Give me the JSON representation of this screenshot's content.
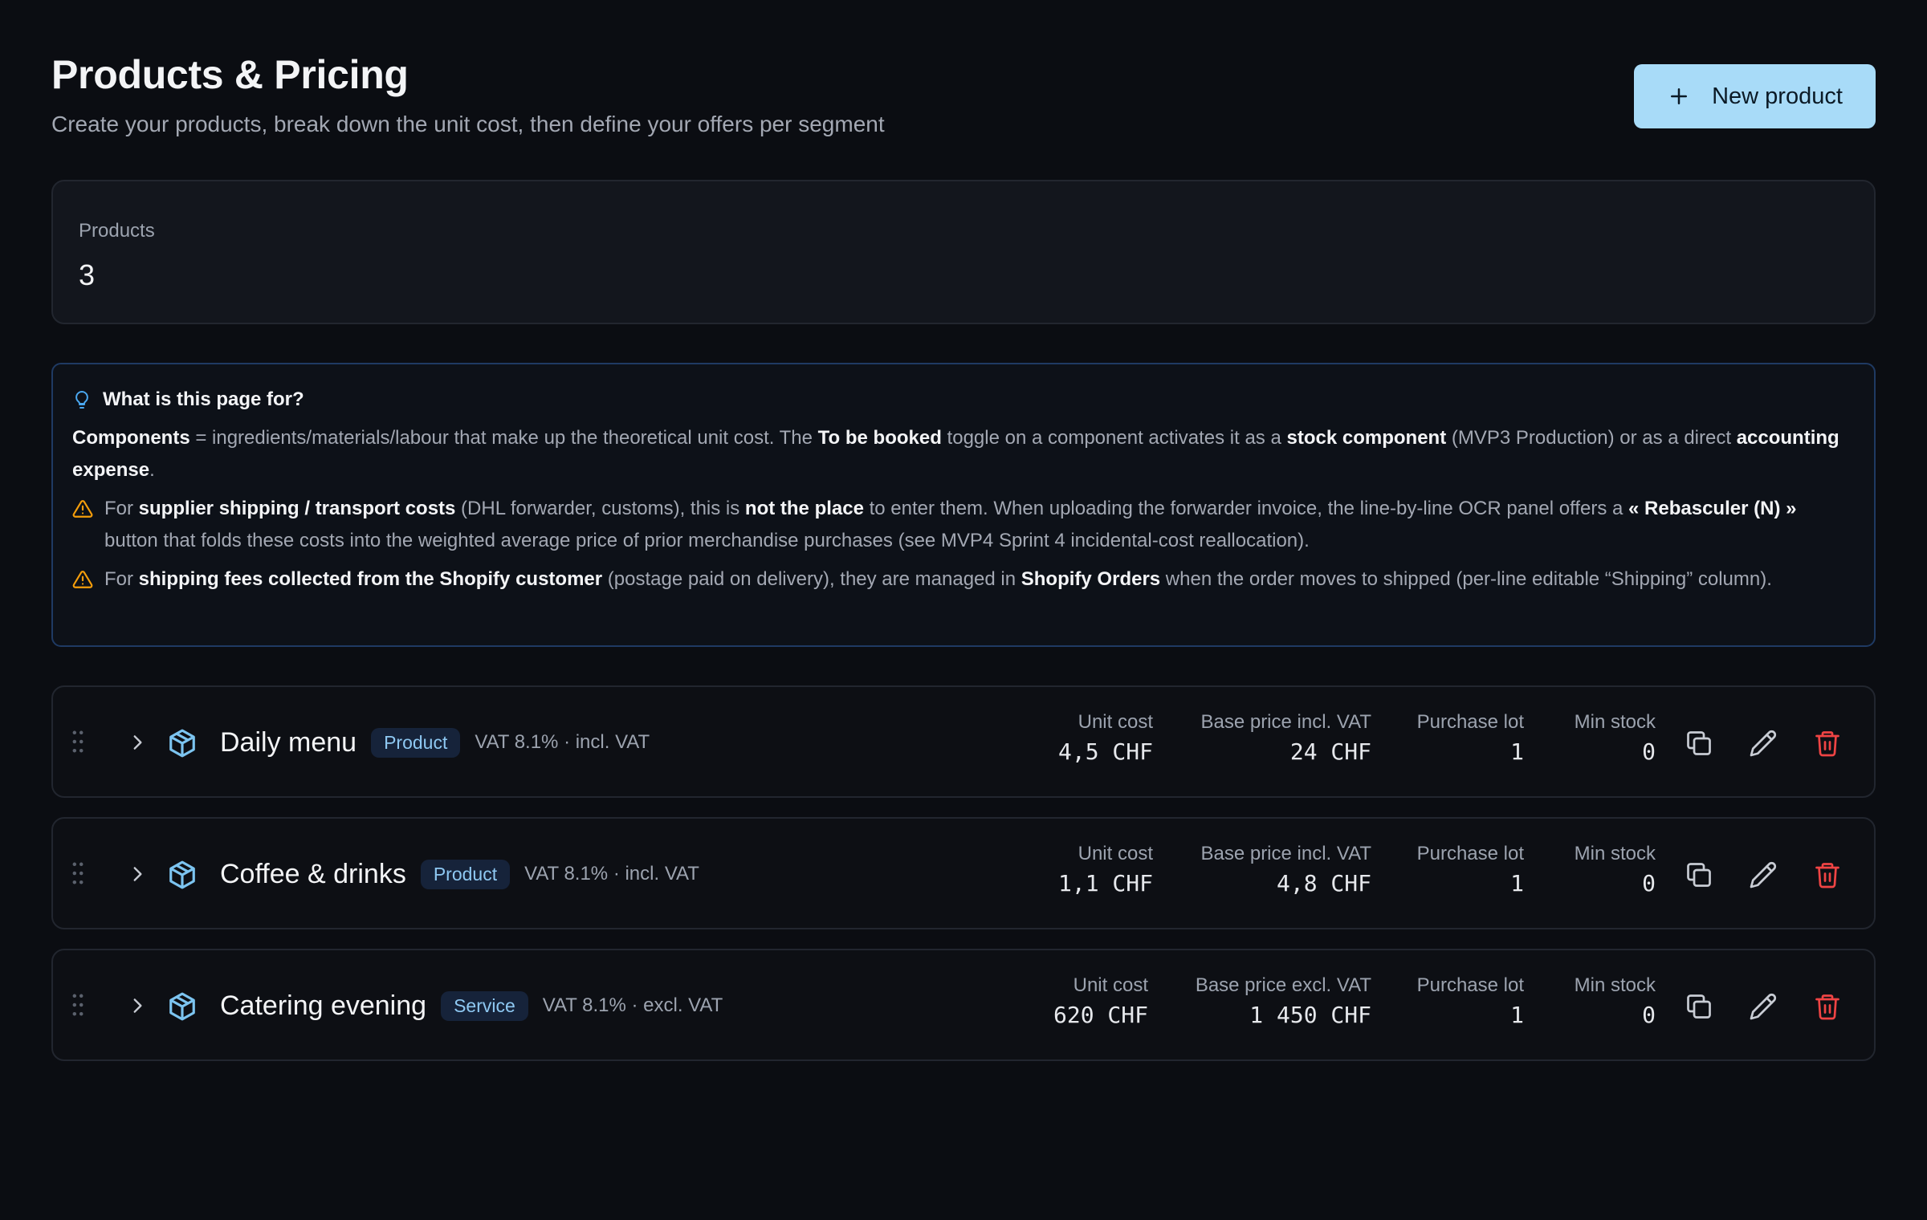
{
  "header": {
    "title": "Products & Pricing",
    "subtitle": "Create your products, break down the unit cost, then define your offers per segment",
    "new_button_label": "New product"
  },
  "stats": {
    "label": "Products",
    "value": "3"
  },
  "info": {
    "title": "What is this page for?",
    "p1": {
      "b1": "Components",
      "t1": " = ingredients/materials/labour that make up the theoretical unit cost. The ",
      "b2": "To be booked",
      "t2": " toggle on a component activates it as a ",
      "b3": "stock component",
      "t3": " (MVP3 Production) or as a direct ",
      "b4": "accounting expense",
      "t4": "."
    },
    "warn1": {
      "t1": "For ",
      "b1": "supplier shipping / transport costs",
      "t2": " (DHL forwarder, customs), this is ",
      "b2": "not the place",
      "t3": " to enter them. When uploading the forwarder invoice, the line-by-line OCR panel offers a ",
      "b3": "« Rebasculer (N) »",
      "t4": " button that folds these costs into the weighted average price of prior merchandise purchases (see MVP4 Sprint 4 incidental-cost reallocation)."
    },
    "warn2": {
      "t1": "For ",
      "b1": "shipping fees collected from the Shopify customer",
      "t2": " (postage paid on delivery), they are managed in ",
      "b2": "Shopify Orders",
      "t3": " when the order moves to shipped (per-line editable “Shipping” column)."
    }
  },
  "labels": {
    "unit_cost": "Unit cost",
    "purchase_lot": "Purchase lot",
    "min_stock": "Min stock"
  },
  "products": [
    {
      "name": "Daily menu",
      "badge": "Product",
      "vat": "VAT 8.1% · incl. VAT",
      "unit_cost": "4,5 CHF",
      "price_label": "Base price incl. VAT",
      "price": "24 CHF",
      "purchase_lot": "1",
      "min_stock": "0"
    },
    {
      "name": "Coffee & drinks",
      "badge": "Product",
      "vat": "VAT 8.1% · incl. VAT",
      "unit_cost": "1,1 CHF",
      "price_label": "Base price incl. VAT",
      "price": "4,8 CHF",
      "purchase_lot": "1",
      "min_stock": "0"
    },
    {
      "name": "Catering evening",
      "badge": "Service",
      "vat": "VAT 8.1% · excl. VAT",
      "unit_cost": "620 CHF",
      "price_label": "Base price excl. VAT",
      "price": "1 450 CHF",
      "purchase_lot": "1",
      "min_stock": "0"
    }
  ],
  "icons": {
    "new": "plus-icon",
    "info": "lightbulb-icon",
    "warning": "warning-triangle-icon",
    "drag": "drag-handle-icon",
    "expand": "chevron-right-icon",
    "product": "package-icon",
    "duplicate": "copy-icon",
    "edit": "pencil-icon",
    "delete": "trash-icon"
  },
  "colors": {
    "accent": "#a8dbf8",
    "danger": "#ef4444",
    "warning": "#f59e0b",
    "info_border": "#1f3a63",
    "product_icon": "#7cc4f0"
  }
}
